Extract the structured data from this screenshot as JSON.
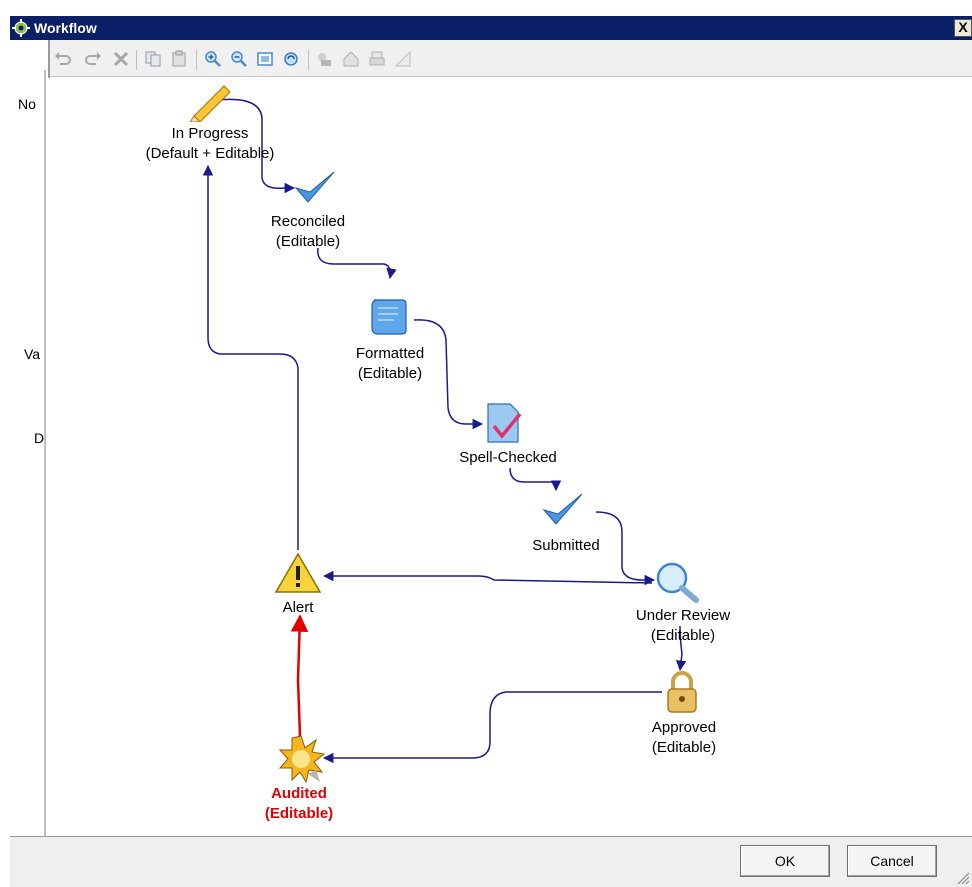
{
  "window": {
    "title": "Workflow",
    "close_label": "X"
  },
  "left_cut_labels": {
    "a": "No",
    "b": "Va",
    "c": "D"
  },
  "toolbar": {
    "icons": [
      "undo-icon",
      "redo-icon",
      "delete-icon",
      "copy-icon",
      "paste-icon",
      "zoom-in-icon",
      "zoom-out-icon",
      "fit-icon",
      "refresh-icon",
      "layout-icon",
      "home-icon",
      "print-icon",
      "triangle-icon"
    ]
  },
  "nodes": {
    "in_progress": {
      "line1": "In Progress",
      "line2": "(Default + Editable)"
    },
    "reconciled": {
      "line1": "Reconciled",
      "line2": "(Editable)"
    },
    "formatted": {
      "line1": "Formatted",
      "line2": "(Editable)"
    },
    "spell_checked": {
      "line1": "Spell-Checked"
    },
    "submitted": {
      "line1": "Submitted"
    },
    "under_review": {
      "line1": "Under Review",
      "line2": "(Editable)"
    },
    "approved": {
      "line1": "Approved",
      "line2": "(Editable)"
    },
    "alert": {
      "line1": "Alert"
    },
    "audited": {
      "line1": "Audited",
      "line2": "(Editable)"
    }
  },
  "colors": {
    "arrow": "#1a1a8c",
    "highlight": "#e00000",
    "titlebar": "#0b1f66"
  },
  "footer": {
    "ok_label": "OK",
    "cancel_label": "Cancel"
  }
}
